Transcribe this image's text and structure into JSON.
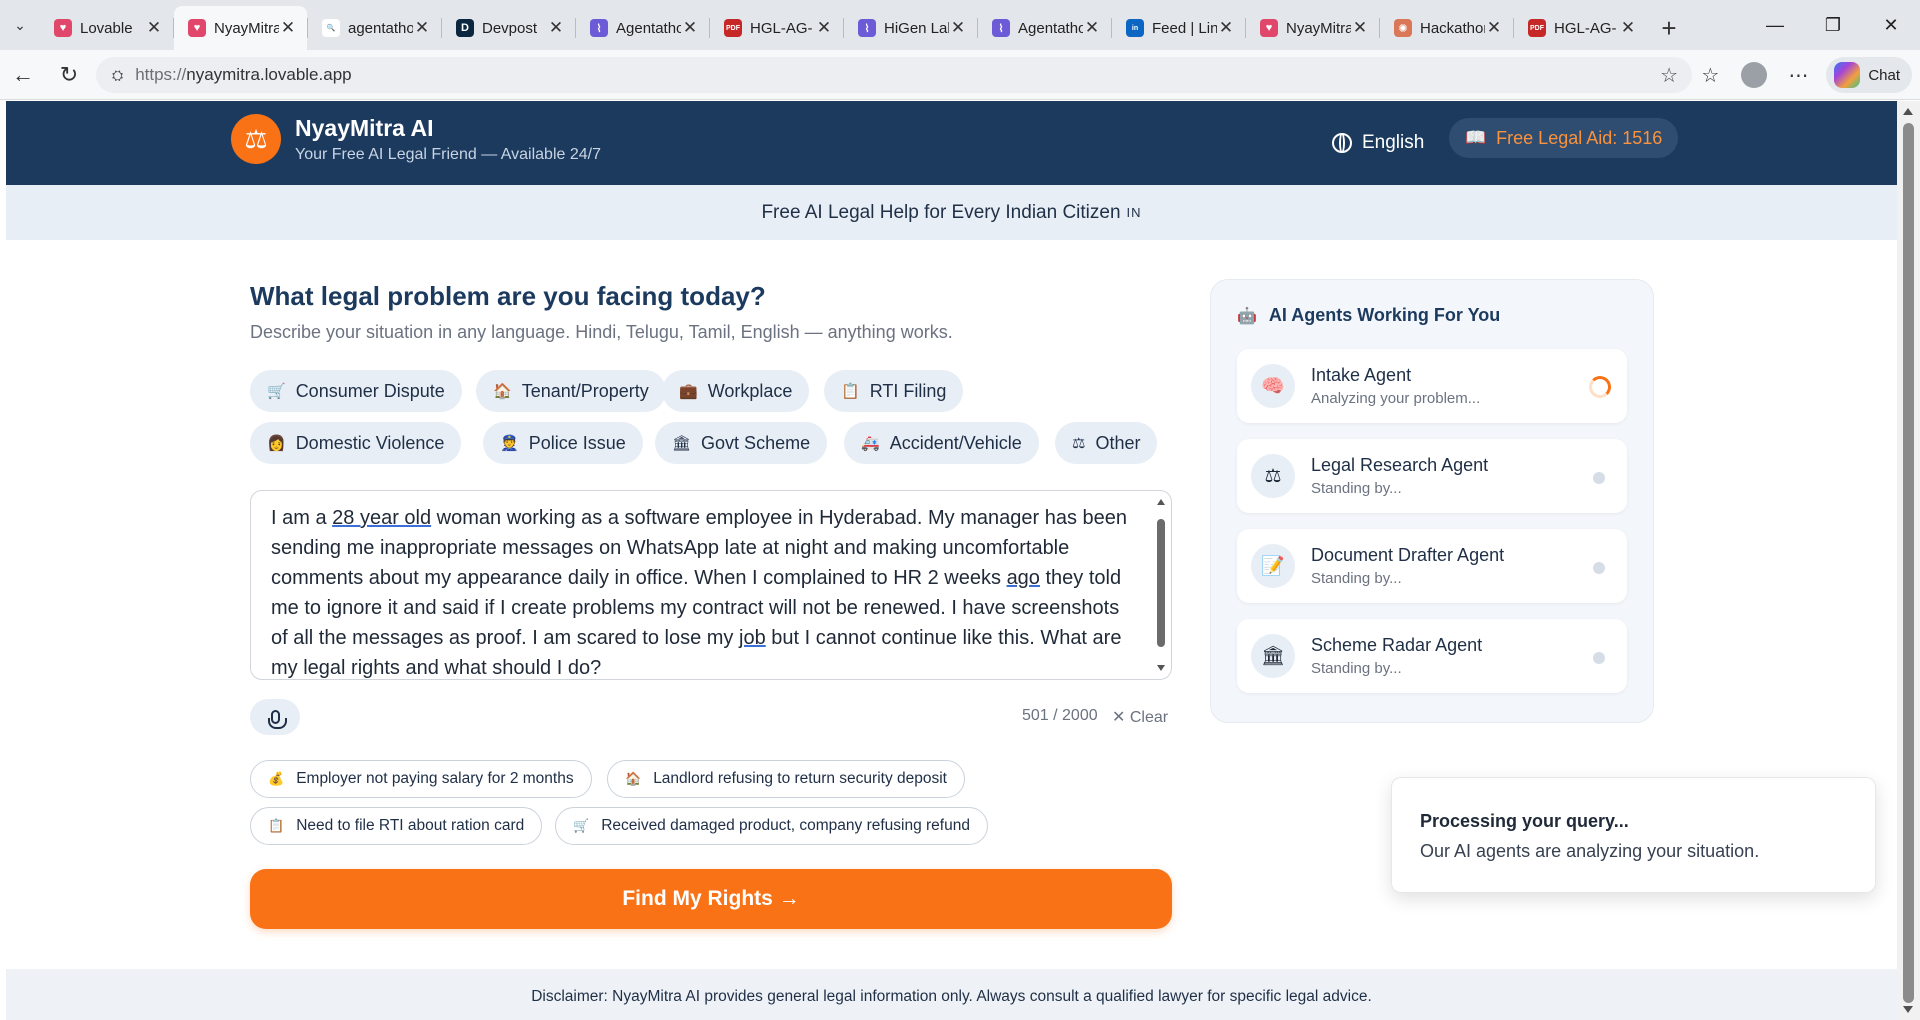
{
  "browser": {
    "tabs": [
      {
        "title": "Lovable",
        "fav": "♥",
        "color": "#e0476b",
        "active": false
      },
      {
        "title": "NyayMitra",
        "fav": "♥",
        "color": "#e0476b",
        "active": true
      },
      {
        "title": "agentathon",
        "fav": "🔍",
        "color": "#ffffff",
        "active": false
      },
      {
        "title": "Devpost",
        "fav": "D",
        "color": "#0b2740",
        "active": false
      },
      {
        "title": "Agentathon",
        "fav": "⌇",
        "color": "#6b5bd6",
        "active": false
      },
      {
        "title": "HGL-AG-",
        "fav": "PDF",
        "color": "#c62828",
        "active": false
      },
      {
        "title": "HiGen Lab",
        "fav": "⌇",
        "color": "#6b5bd6",
        "active": false
      },
      {
        "title": "Agentathon",
        "fav": "⌇",
        "color": "#6b5bd6",
        "active": false
      },
      {
        "title": "Feed | LinkedIn",
        "fav": "in",
        "color": "#0a66c2",
        "active": false
      },
      {
        "title": "NyayMitra",
        "fav": "♥",
        "color": "#e0476b",
        "active": false
      },
      {
        "title": "Hackathon",
        "fav": "✺",
        "color": "#d97757",
        "active": false
      },
      {
        "title": "HGL-AG-",
        "fav": "PDF",
        "color": "#c62828",
        "active": false
      }
    ],
    "url_proto": "https://",
    "url_host": "nyaymitra.lovable.app",
    "chat_label": "Chat"
  },
  "header": {
    "logo_icon": "⚖",
    "brand_name": "NyayMitra AI",
    "brand_tagline": "Your Free AI Legal Friend — Available 24/7",
    "language": "English",
    "aid_badge": "Free Legal Aid: 1516"
  },
  "banner": {
    "text": "Free AI Legal Help for Every Indian Citizen",
    "flag": "IN"
  },
  "main": {
    "title": "What legal problem are you facing today?",
    "subtitle": "Describe your situation in any language. Hindi, Telugu, Tamil, English — anything works.",
    "categories": [
      {
        "icon": "🛒",
        "label": "Consumer Dispute"
      },
      {
        "icon": "🏠",
        "label": "Tenant/Property"
      },
      {
        "icon": "💼",
        "label": "Workplace"
      },
      {
        "icon": "📋",
        "label": "RTI Filing"
      },
      {
        "icon": "👩",
        "label": "Domestic Violence"
      },
      {
        "icon": "👮",
        "label": "Police Issue"
      },
      {
        "icon": "🏛",
        "label": "Govt Scheme"
      },
      {
        "icon": "🚑",
        "label": "Accident/Vehicle"
      },
      {
        "icon": "⚖",
        "label": "Other"
      }
    ],
    "problem_text": "I am a 28 year old woman working as a software employee in Hyderabad. My manager has been sending me inappropriate messages on WhatsApp late at night and making uncomfortable comments about my appearance daily in office. When I complained to HR 2 weeks ago they told me to ignore it and said if I create problems my contract will not be renewed. I have screenshots of all the messages as proof. I am scared to lose my job but I cannot continue like this. What are my legal rights and what should I do?",
    "char_count": "501 / 2000",
    "clear_label": "Clear",
    "examples": [
      {
        "icon": "💰",
        "label": "Employer not paying salary for 2 months"
      },
      {
        "icon": "🏠",
        "label": "Landlord refusing to return security deposit"
      },
      {
        "icon": "📋",
        "label": "Need to file RTI about ration card"
      },
      {
        "icon": "🛒",
        "label": "Received damaged product, company refusing refund"
      }
    ],
    "cta_label": "Find My Rights →"
  },
  "agents": {
    "title": "AI Agents Working For You",
    "title_icon": "🤖",
    "items": [
      {
        "icon": "🧠",
        "name": "Intake Agent",
        "status": "Analyzing your problem...",
        "state": "active"
      },
      {
        "icon": "⚖",
        "name": "Legal Research Agent",
        "status": "Standing by...",
        "state": "idle"
      },
      {
        "icon": "📝",
        "name": "Document Drafter Agent",
        "status": "Standing by...",
        "state": "idle"
      },
      {
        "icon": "🏛",
        "name": "Scheme Radar Agent",
        "status": "Standing by...",
        "state": "idle"
      }
    ]
  },
  "footer": {
    "disclaimer": "Disclaimer: NyayMitra AI provides general legal information only. Always consult a qualified lawyer for specific legal advice."
  },
  "toast": {
    "title": "Processing your query...",
    "message": "Our AI agents are analyzing your situation."
  },
  "colors": {
    "primary_navy": "#1c3a5e",
    "accent_orange": "#f97316",
    "chip_bg": "#e8eef6"
  }
}
